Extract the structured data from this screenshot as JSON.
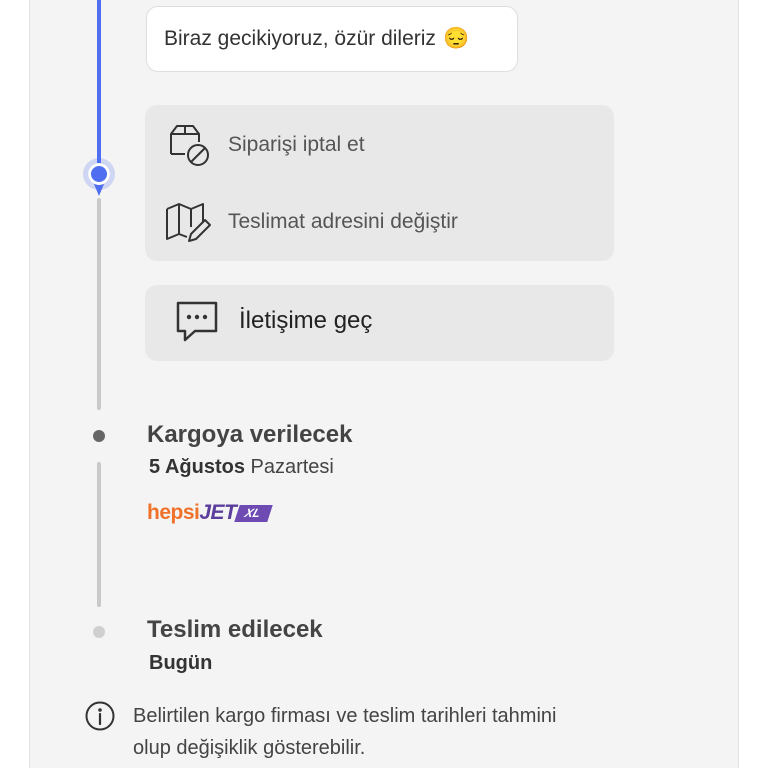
{
  "message": {
    "text": "Biraz gecikiyoruz, özür dileriz",
    "emoji": "😔"
  },
  "actions": [
    {
      "label": "Siparişi iptal et",
      "icon": "package-cancel-icon"
    },
    {
      "label": "Teslimat adresini değiştir",
      "icon": "map-edit-icon"
    }
  ],
  "contact": {
    "label": "İletişime geç",
    "icon": "chat-bubble-icon"
  },
  "timeline": [
    {
      "title": "Kargoya verilecek",
      "date_bold": "5 Ağustos",
      "date_rest": " Pazartesi",
      "carrier": {
        "part1": "hepsi",
        "part2": "JET",
        "badge": "XL"
      }
    },
    {
      "title": "Teslim edilecek",
      "date_bold": "Bugün"
    }
  ],
  "info": {
    "icon": "info-icon",
    "line1": "Belirtilen kargo firması ve teslim tarihleri tahmini",
    "line2": "olup değişiklik gösterebilir."
  },
  "colors": {
    "accent": "#4f6ef0",
    "panel": "#f4f4f4",
    "card": "#e8e8e8",
    "brand_orange": "#f0722a",
    "brand_purple": "#5b3d9c"
  }
}
